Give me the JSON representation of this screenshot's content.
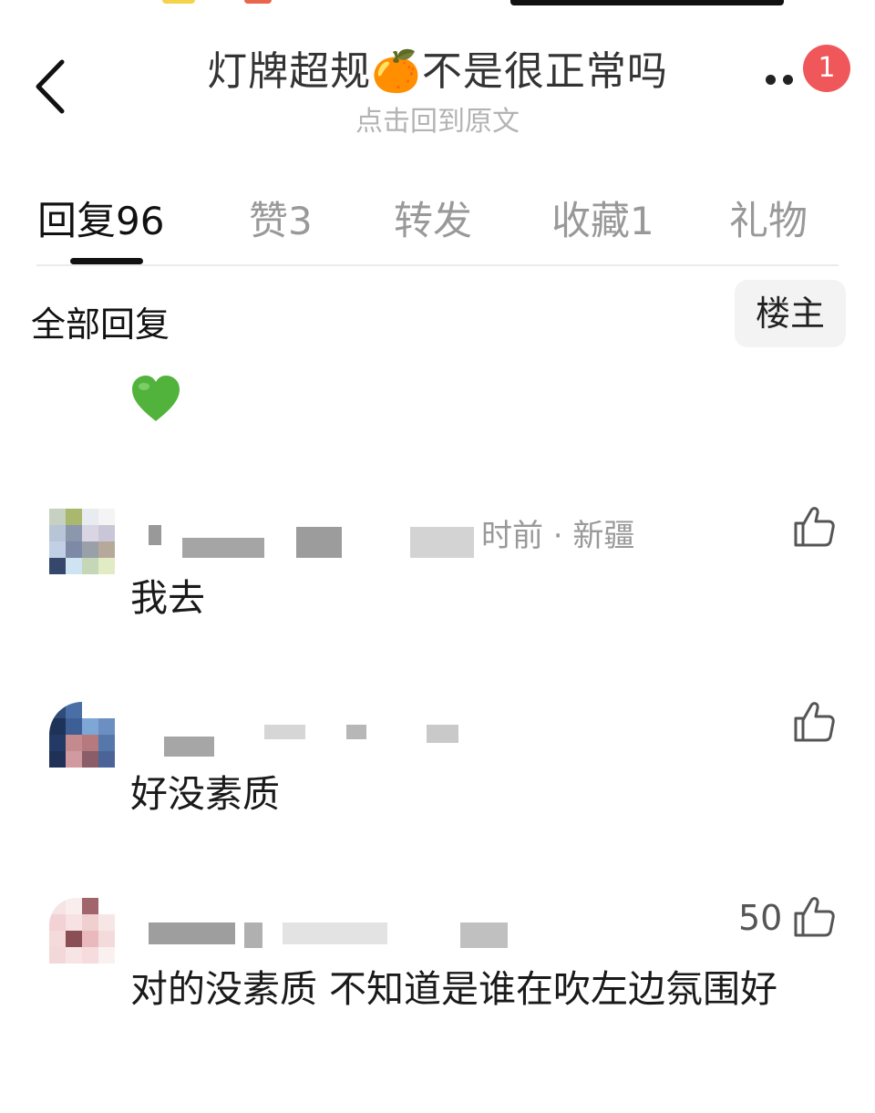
{
  "header": {
    "title": "灯牌超规🍊不是很正常吗",
    "subtitle": "点击回到原文",
    "notification_badge": "1"
  },
  "tabs": [
    {
      "label": "回复",
      "count": "96",
      "active": true
    },
    {
      "label": "赞",
      "count": "3",
      "active": false
    },
    {
      "label": "转发",
      "count": "",
      "active": false
    },
    {
      "label": "收藏",
      "count": "1",
      "active": false
    },
    {
      "label": "礼物",
      "count": "",
      "active": false
    }
  ],
  "section": {
    "title": "全部回复",
    "filter_label": "楼主"
  },
  "first_reply_emoji": "💚",
  "comments": [
    {
      "meta": "时前 · 新疆",
      "text": "我去",
      "like_count": ""
    },
    {
      "meta": "",
      "text": "好没素质",
      "like_count": ""
    },
    {
      "meta": "",
      "text": "对的没素质 不知道是谁在吹左边氛围好",
      "like_count": "50"
    }
  ],
  "colors": {
    "accent_badge": "#f0575a",
    "heart": "#52b33c",
    "secondary_text": "#999999"
  }
}
